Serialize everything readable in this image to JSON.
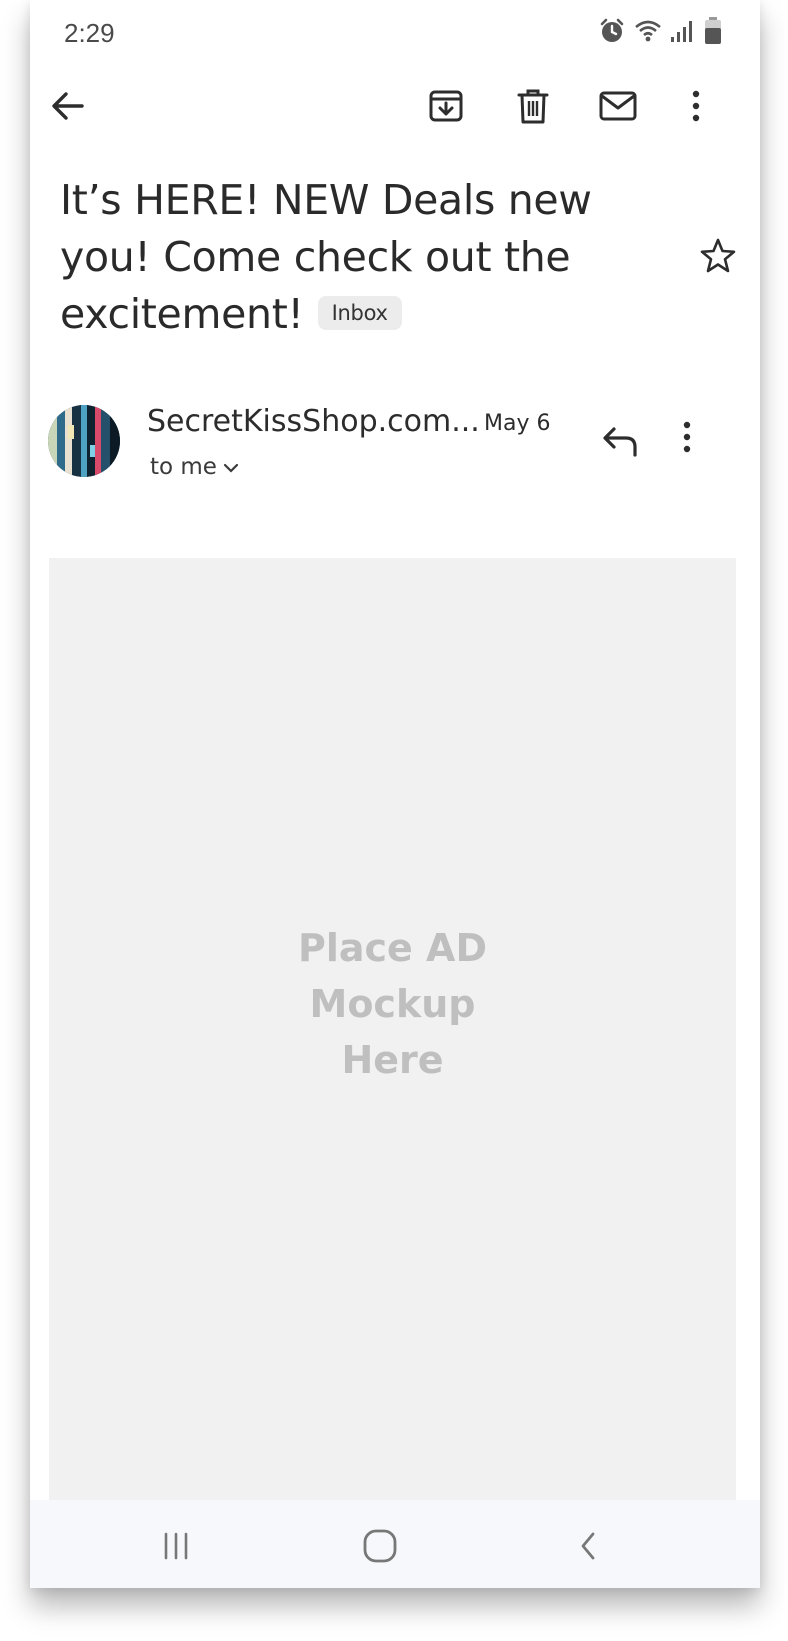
{
  "status_bar": {
    "time": "2:29",
    "icons": [
      "alarm-icon",
      "wifi-icon",
      "signal-icon",
      "battery-icon"
    ]
  },
  "toolbar": {
    "icons": [
      "back-arrow-icon",
      "archive-icon",
      "trash-icon",
      "mark-unread-icon",
      "more-vertical-icon"
    ]
  },
  "email": {
    "subject": "It’s HERE! NEW Deals new you! Come check out the excitement!",
    "label": "Inbox",
    "sender": "SecretKissShop.com...",
    "date": "May 6",
    "recipient": "to me"
  },
  "ad": {
    "placeholder": "Place AD\nMockup\nHere"
  },
  "nav": {
    "icons": [
      "recent-apps-icon",
      "home-icon",
      "back-icon"
    ]
  },
  "colors": {
    "text": "#2a2a2a",
    "ad_background": "#f1f1f1",
    "ad_text": "#bfbfbf",
    "badge": "#ececec",
    "navbar": "#f7f8fb"
  }
}
